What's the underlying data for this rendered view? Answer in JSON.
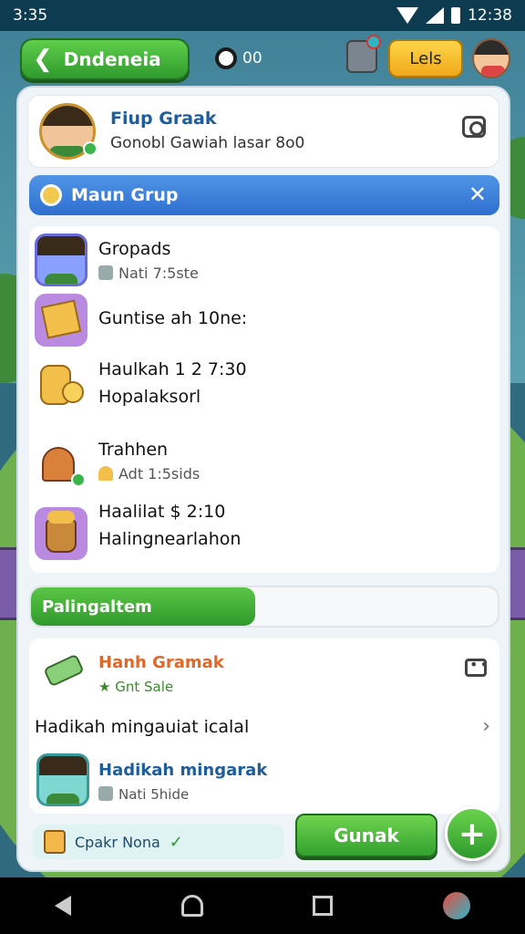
{
  "status_bar": {
    "time": "3:35",
    "clock": "12:38"
  },
  "header": {
    "back_label": "Dndeneia",
    "coins_value": "00",
    "labs_label": "Lels"
  },
  "profile": {
    "name": "Fiup Graak",
    "subtitle": "Gonobl Gawiah lasar 8o0"
  },
  "group_bar": {
    "title": "Maun Grup"
  },
  "list": {
    "items": [
      {
        "line1": "Gropads",
        "line2": "Nati 7:5ste"
      },
      {
        "line1": "Guntise ah 10ne:",
        "line2": ""
      },
      {
        "line1": "Haulkah 1 2 7:30",
        "line2": "Hopalaksorl"
      },
      {
        "line1": "Trahhen",
        "line2": "Adt 1:5sids"
      },
      {
        "line1": "Haalilat $ 2:10",
        "line2": "Halingnearlahon"
      }
    ]
  },
  "progress": {
    "label": "Palingaltem",
    "value": 0.48
  },
  "friends": {
    "first_name": "Hanh Gramak",
    "first_status": "Gnt Sale",
    "row_text": "Hadikah mingauiat icalal",
    "second_name": "Hadikah mingarak",
    "second_sub": "Nati 5hide"
  },
  "footer": {
    "status_text": "Cpakr Nona",
    "send_label": "Gunak",
    "fab_label": "+"
  },
  "colors": {
    "accent_green": "#2f9a2d",
    "accent_blue": "#2f6fcf",
    "accent_orange": "#e0672a"
  }
}
